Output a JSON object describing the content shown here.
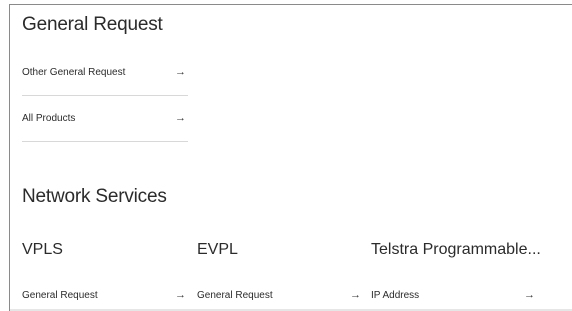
{
  "general_request": {
    "title": "General Request",
    "links": [
      {
        "label": "Other General Request",
        "arrow": "→"
      },
      {
        "label": "All Products",
        "arrow": "→"
      }
    ]
  },
  "network_services": {
    "title": "Network Services",
    "columns": [
      {
        "title": "VPLS",
        "link": {
          "label": "General Request",
          "arrow": "→"
        }
      },
      {
        "title": "EVPL",
        "link": {
          "label": "General Request",
          "arrow": "→"
        }
      },
      {
        "title": "Telstra Programmable...",
        "link": {
          "label": "IP Address",
          "arrow": "→"
        }
      }
    ]
  }
}
